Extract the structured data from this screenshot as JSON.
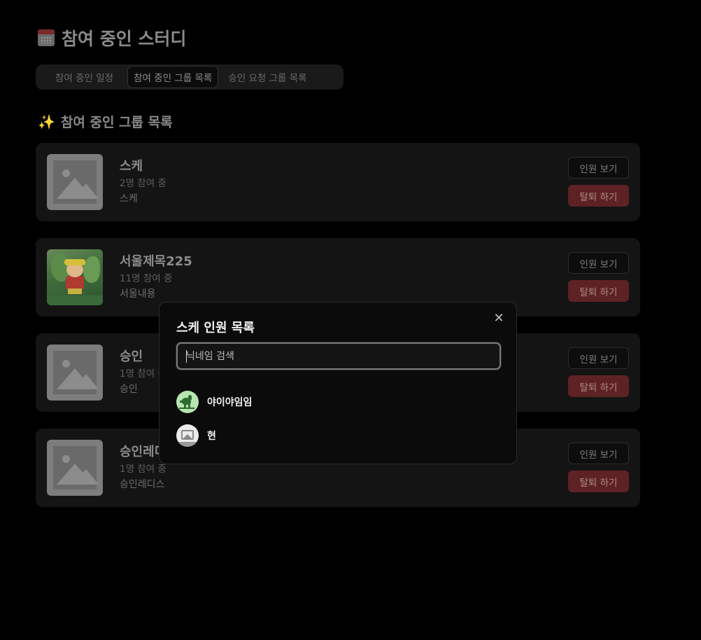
{
  "header": {
    "title": "참여 중인 스터디",
    "icon": "calendar-icon"
  },
  "tabs": [
    {
      "label": "참여 중인 일정",
      "active": false
    },
    {
      "label": "참여 중인 그룹 목록",
      "active": true
    },
    {
      "label": "승인 요청 그룹 목록",
      "active": false
    }
  ],
  "section": {
    "title": "참여 중인 그룹 목록",
    "icon": "sparkles-icon"
  },
  "groups": [
    {
      "title": "스케",
      "count": "2명 참여 중",
      "desc": "스케",
      "thumbnail": "placeholder-image",
      "members_label": "인원 보기",
      "leave_label": "탈퇴 하기"
    },
    {
      "title": "서울제목225",
      "count": "11명 참여 중",
      "desc": "서울내용",
      "thumbnail": "cartoon-character-image",
      "members_label": "인원 보기",
      "leave_label": "탈퇴 하기"
    },
    {
      "title": "승인",
      "count": "1명 참여 중",
      "desc": "승인",
      "thumbnail": "placeholder-image",
      "members_label": "인원 보기",
      "leave_label": "탈퇴 하기"
    },
    {
      "title": "승인레디스",
      "count": "1명 참여 중",
      "desc": "승인레디스",
      "thumbnail": "placeholder-image",
      "members_label": "인원 보기",
      "leave_label": "탈퇴 하기"
    }
  ],
  "modal": {
    "title": "스케 인원 목록",
    "close_icon": "close-icon",
    "search": {
      "value": "",
      "placeholder": "닉네임 검색"
    },
    "members": [
      {
        "name": "야이야임임",
        "avatar": "dinosaur-avatar"
      },
      {
        "name": "현",
        "avatar": "placeholder-image-avatar"
      }
    ]
  },
  "colors": {
    "background": "#000000",
    "card": "#141414",
    "leave_button": "#5e2224",
    "modal": "#0b0b0b"
  }
}
